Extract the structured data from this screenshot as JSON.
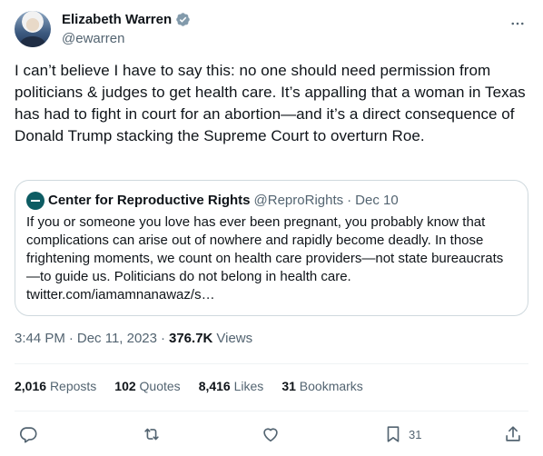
{
  "author": {
    "name": "Elizabeth Warren",
    "handle": "@ewarren"
  },
  "tweet": {
    "text": "I can’t believe I have to say this: no one should need permission from politicians & judges to get health care. It’s appalling that a woman in Texas has had to fight in court for an abortion—and it’s a direct consequence of Donald Trump stacking the Supreme Court to overturn Roe."
  },
  "quote": {
    "name": "Center for Reproductive Rights",
    "handle": "@ReproRights",
    "separator": "·",
    "date": "Dec 10",
    "text": "If you or someone you love has ever been pregnant, you probably know that complications can arise out of nowhere and rapidly become deadly. In those frightening moments, we count on health care providers—not state bureaucrats—to guide us. Politicians do not belong in health care. twitter.com/iamamnanawaz/s…"
  },
  "meta": {
    "time": "3:44 PM",
    "sep1": "·",
    "date": "Dec 11, 2023",
    "sep2": "·",
    "views_count": "376.7K",
    "views_label": "Views"
  },
  "stats": {
    "reposts_count": "2,016",
    "reposts_label": "Reposts",
    "quotes_count": "102",
    "quotes_label": "Quotes",
    "likes_count": "8,416",
    "likes_label": "Likes",
    "bookmarks_count": "31",
    "bookmarks_label": "Bookmarks"
  },
  "actions": {
    "bookmark_count": "31"
  },
  "icons": {
    "verified": "verified-badge-icon",
    "more": "more-horizontal-icon",
    "reply": "reply-icon",
    "repost": "repost-icon",
    "like": "heart-icon",
    "bookmark": "bookmark-icon",
    "share": "share-icon"
  },
  "colors": {
    "verified": "#829aab",
    "text": "#0f1419",
    "secondary": "#536471",
    "border": "#cfd9de"
  }
}
